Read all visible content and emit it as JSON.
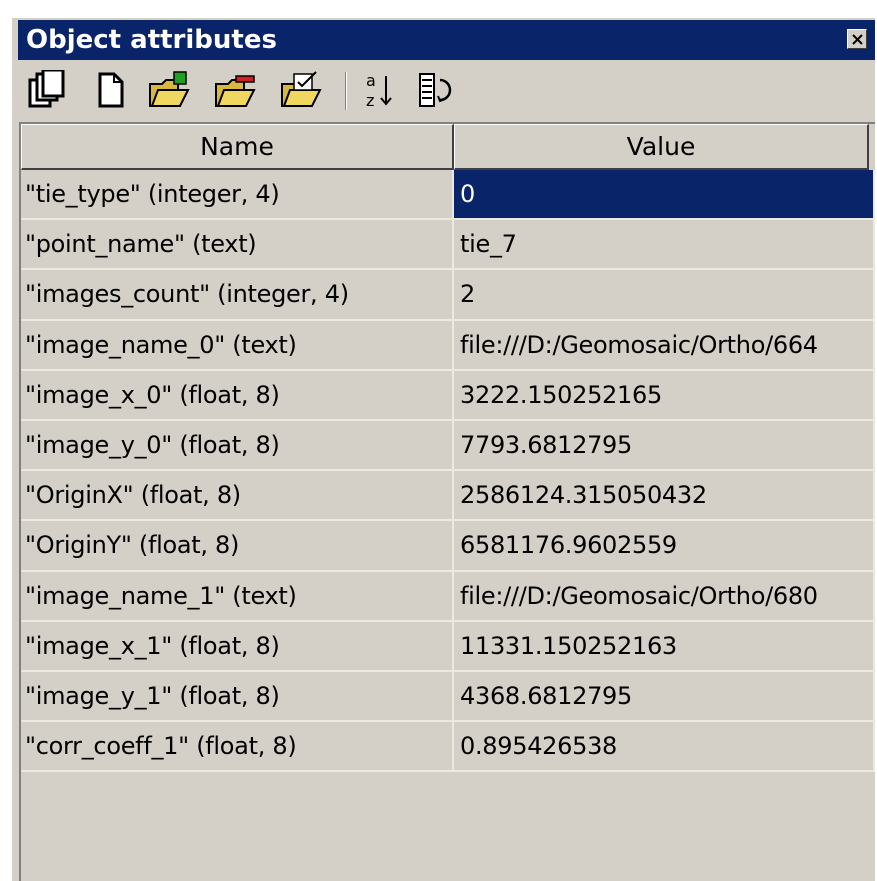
{
  "window": {
    "title": "Object attributes",
    "accent_color": "#0a246a",
    "close_icon": "close-x-icon"
  },
  "toolbar": {
    "buttons": [
      {
        "name": "copy-all-button",
        "icon": "copy-icon"
      },
      {
        "name": "new-button",
        "icon": "new-document-icon"
      },
      {
        "name": "add-attribute-button",
        "icon": "folder-add-icon"
      },
      {
        "name": "delete-attribute-button",
        "icon": "folder-remove-icon"
      },
      {
        "name": "edit-attribute-button",
        "icon": "folder-edit-icon"
      },
      {
        "name": "sort-button",
        "icon": "sort-az-icon"
      },
      {
        "name": "reset-button",
        "icon": "list-refresh-icon"
      }
    ]
  },
  "table": {
    "columns": [
      "Name",
      "Value"
    ],
    "selected_row": 0,
    "rows": [
      {
        "name": "\"tie_type\" (integer, 4)",
        "value": "0"
      },
      {
        "name": "\"point_name\" (text)",
        "value": "tie_7"
      },
      {
        "name": "\"images_count\" (integer, 4)",
        "value": "2"
      },
      {
        "name": "\"image_name_0\" (text)",
        "value": "file:///D:/Geomosaic/Ortho/664"
      },
      {
        "name": "\"image_x_0\" (float, 8)",
        "value": "3222.150252165"
      },
      {
        "name": "\"image_y_0\" (float, 8)",
        "value": "7793.6812795"
      },
      {
        "name": "\"OriginX\" (float, 8)",
        "value": "2586124.315050432"
      },
      {
        "name": "\"OriginY\" (float, 8)",
        "value": "6581176.9602559"
      },
      {
        "name": "\"image_name_1\" (text)",
        "value": "file:///D:/Geomosaic/Ortho/680"
      },
      {
        "name": "\"image_x_1\" (float, 8)",
        "value": "11331.150252163"
      },
      {
        "name": "\"image_y_1\" (float, 8)",
        "value": "4368.6812795"
      },
      {
        "name": "\"corr_coeff_1\" (float, 8)",
        "value": "0.895426538"
      }
    ]
  }
}
